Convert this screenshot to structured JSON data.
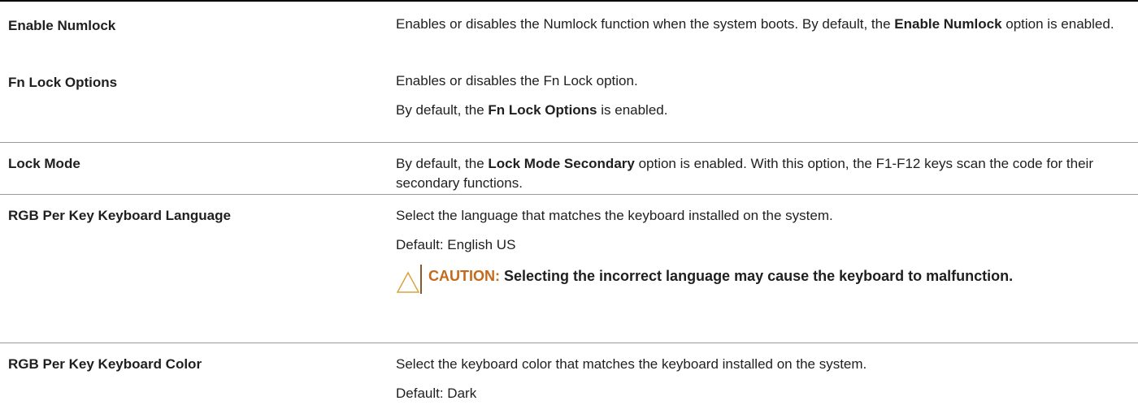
{
  "rows": [
    {
      "label": "Enable Numlock",
      "desc": [
        {
          "pre": "Enables or disables the Numlock function when the system boots. By default, the ",
          "bold": "Enable Numlock",
          "post": " option is enabled."
        }
      ]
    },
    {
      "label": "Fn Lock Options",
      "desc": [
        {
          "pre": "Enables or disables the Fn Lock option.",
          "bold": "",
          "post": ""
        },
        {
          "pre": "By default, the ",
          "bold": "Fn Lock Options",
          "post": " is enabled."
        }
      ]
    },
    {
      "label": "Lock Mode",
      "desc": [
        {
          "pre": "By default, the ",
          "bold": "Lock Mode Secondary",
          "post": " option is enabled. With this option, the F1-F12 keys scan the code for their secondary functions."
        }
      ]
    },
    {
      "label": "RGB Per Key Keyboard Language",
      "desc": [
        {
          "pre": "Select the language that matches the keyboard installed on the system.",
          "bold": "",
          "post": ""
        },
        {
          "pre": "Default: English US",
          "bold": "",
          "post": ""
        }
      ],
      "caution": {
        "label": "CAUTION:",
        "text": " Selecting the incorrect language may cause the keyboard to malfunction."
      }
    },
    {
      "label": "RGB Per Key Keyboard Color",
      "desc": [
        {
          "pre": "Select the keyboard color that matches the keyboard installed on the system.",
          "bold": "",
          "post": ""
        },
        {
          "pre": "Default: Dark",
          "bold": "",
          "post": ""
        }
      ]
    }
  ],
  "colors": {
    "caution_label": "#c46a1c",
    "caution_icon": "#d9a441",
    "rule": "#9a9a9a"
  },
  "icons": {
    "caution": "warning-triangle-icon"
  }
}
